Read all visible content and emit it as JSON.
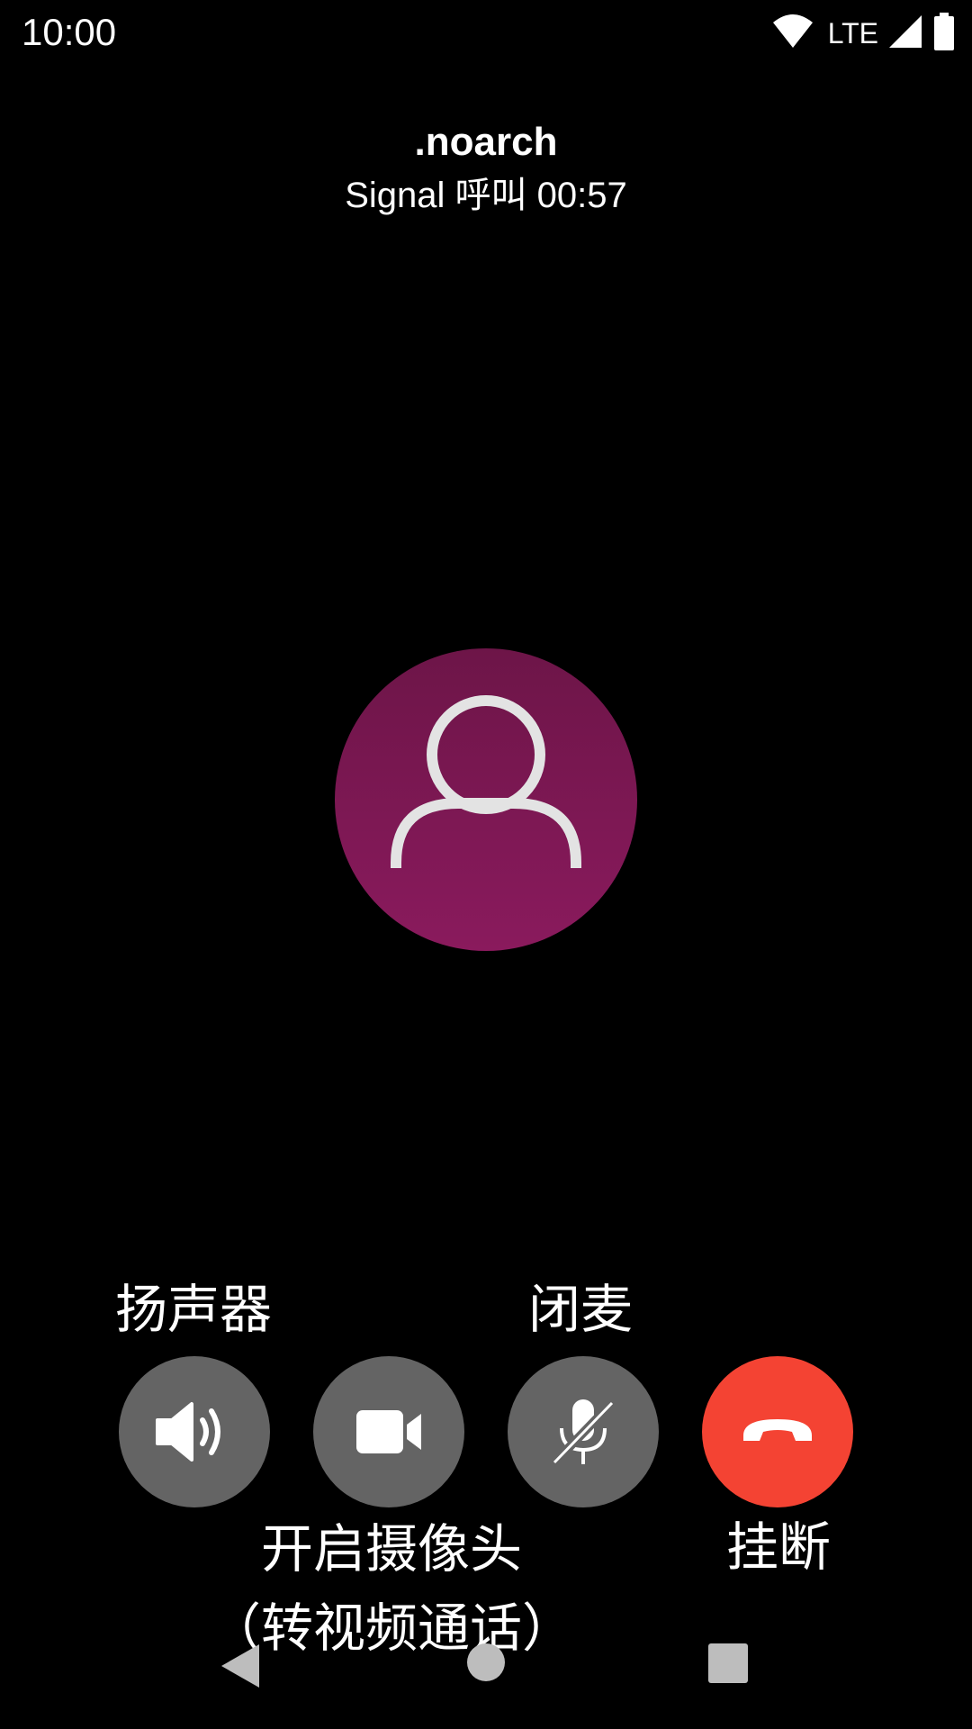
{
  "status_bar": {
    "time": "10:00",
    "network_label": "LTE",
    "icons": [
      "wifi-icon",
      "cell-signal-icon",
      "battery-icon"
    ]
  },
  "call": {
    "contact_name": ".noarch",
    "status_text": "Signal 呼叫 00:57"
  },
  "avatar": {
    "icon": "person-icon",
    "color_top": "#6d1548",
    "color_bottom": "#8a1a5d"
  },
  "controls": {
    "speaker_label": "扬声器",
    "mute_label": "闭麦",
    "camera_label_line1": "开启摄像头",
    "camera_label_line2": "（转视频通话）",
    "hangup_label": "挂断",
    "button_color": "#646464",
    "hangup_color": "#f44333"
  },
  "nav": {
    "icons": [
      "back-icon",
      "home-icon",
      "recents-icon"
    ]
  }
}
